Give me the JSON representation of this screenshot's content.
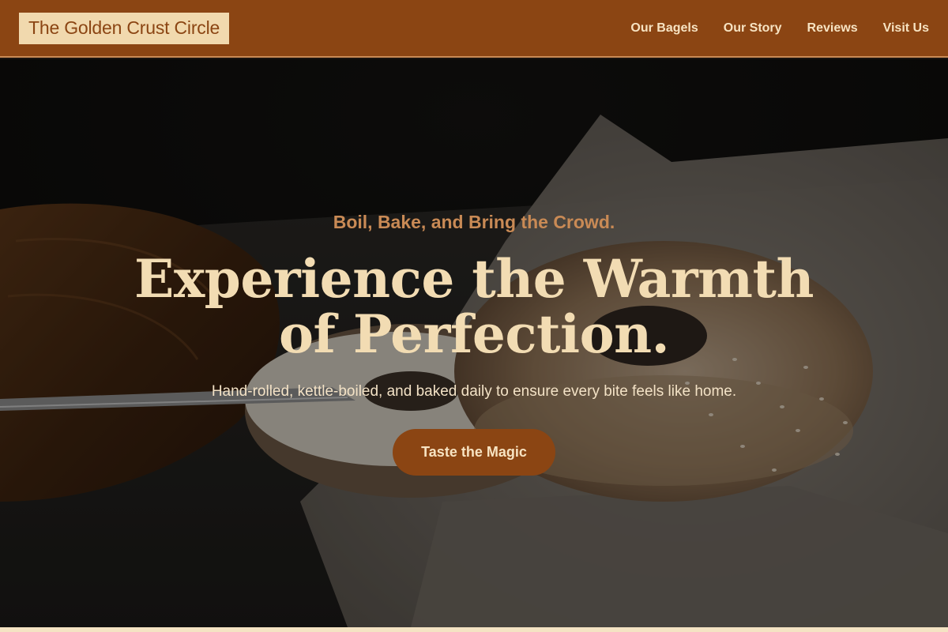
{
  "brand": {
    "name": "The Golden Crust Circle"
  },
  "nav": {
    "items": [
      {
        "label": "Our Bagels"
      },
      {
        "label": "Our Story"
      },
      {
        "label": "Reviews"
      },
      {
        "label": "Visit Us"
      }
    ]
  },
  "hero": {
    "tagline": "Boil, Bake, and Bring the Crowd.",
    "headline_line1": "Experience the Warmth",
    "headline_line2": "of Perfection.",
    "subtext": "Hand-rolled, kettle-boiled, and baked daily to ensure every bite feels like home.",
    "cta_label": "Taste the Magic",
    "background_image": "bagel-with-cream-cheese-photo"
  },
  "colors": {
    "brand_brown": "#8b4513",
    "cream": "#f1d9ae",
    "tagline_copper": "#c98a55",
    "headline_cream": "#f2dcb3"
  }
}
